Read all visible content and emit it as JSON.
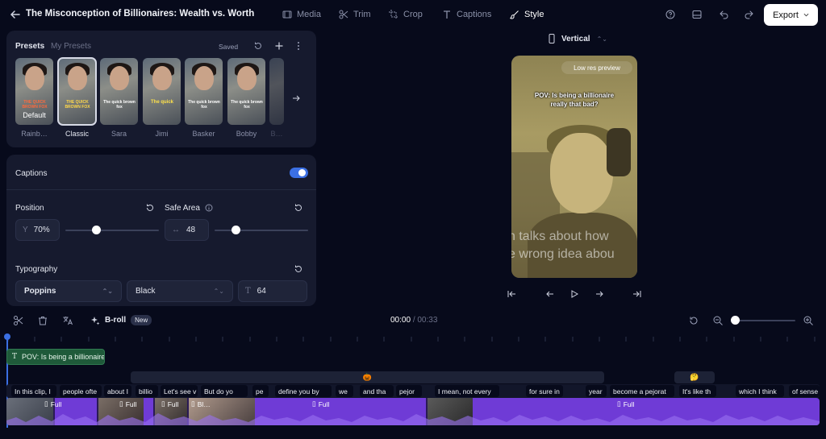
{
  "header": {
    "title": "The Misconception of Billionaires: Wealth vs. Worth",
    "tabs": [
      {
        "label": "Media",
        "icon": "film-icon"
      },
      {
        "label": "Trim",
        "icon": "scissors-icon"
      },
      {
        "label": "Crop",
        "icon": "crop-icon"
      },
      {
        "label": "Captions",
        "icon": "text-icon"
      },
      {
        "label": "Style",
        "icon": "brush-icon",
        "active": true
      }
    ],
    "export_label": "Export"
  },
  "presets": {
    "tab_presets": "Presets",
    "tab_my_presets": "My Presets",
    "saved_label": "Saved",
    "default_label": "Default",
    "items": [
      {
        "name": "Rainb…",
        "caption": "THE QUICK BROWN FOX"
      },
      {
        "name": "Classic",
        "caption": "THE QUICK BROWN FOX",
        "selected": true
      },
      {
        "name": "Sara",
        "caption": "The quick brown fox"
      },
      {
        "name": "Jimi",
        "caption": "The quick"
      },
      {
        "name": "Basker",
        "caption": "The quick brown fox"
      },
      {
        "name": "Bobby",
        "caption": "The quick brown fox"
      },
      {
        "name": "B…",
        "caption": ""
      }
    ]
  },
  "captions": {
    "label": "Captions",
    "enabled": true,
    "position_label": "Position",
    "position_axis": "Y",
    "position_value": "70%",
    "position_fraction": 0.31,
    "safe_area_label": "Safe Area",
    "safe_area_value": "48",
    "safe_area_fraction": 0.2,
    "typography_label": "Typography",
    "font_value": "Poppins",
    "weight_value": "Black",
    "size_value": "64"
  },
  "preview": {
    "orientation": "Vertical",
    "badge": "Low res preview",
    "caption_line1": "POV: Is being a billionaire",
    "caption_line2": "really that bad?",
    "subtitle_line1": "n talks about how",
    "subtitle_line2": "e wrong idea abou"
  },
  "timeline": {
    "broll_label": "B-roll",
    "broll_badge": "New",
    "time_current": "00:00",
    "time_total": "/ 00:33",
    "zoom_fraction": 0.0,
    "text_clip": "POV: Is being a billionaire",
    "emoji_1": "🎃",
    "emoji_2": "🤔",
    "words": [
      "In this clip, I",
      "people ofte",
      "about I",
      "billio",
      "Let's see v",
      "But do yo",
      "pe",
      "define you by",
      "we",
      "and tha",
      "pejor",
      "I mean, not every",
      "for sure in",
      "year",
      "become a pejorat",
      "It's like th",
      "which I think",
      "of sense"
    ],
    "video_clips": [
      "Full",
      "Full",
      "Full",
      "Bl…",
      "Full",
      "Full"
    ]
  },
  "colors": {
    "accent": "#3b6fe3",
    "clip_purple": "#6f3bd6",
    "text_clip_green": "#1f5a3a",
    "background": "#070a1b",
    "panel": "#161a2e"
  }
}
